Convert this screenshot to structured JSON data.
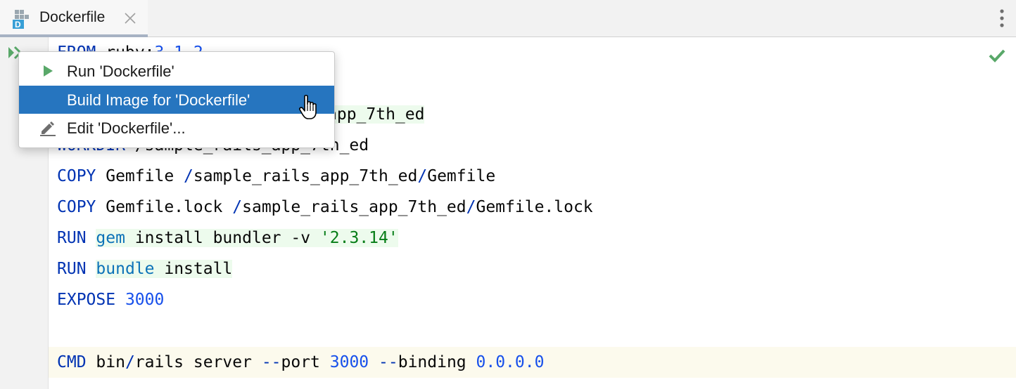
{
  "tab": {
    "title": "Dockerfile",
    "icon": "dockerfile-icon",
    "icon_letter": "D"
  },
  "menu": {
    "items": [
      {
        "label": "Run 'Dockerfile'",
        "icon": "run-icon"
      },
      {
        "label": "Build Image for 'Dockerfile'",
        "icon": "",
        "selected": true
      },
      {
        "label": "Edit 'Dockerfile'...",
        "icon": "edit-pencil-icon"
      }
    ]
  },
  "code": {
    "line1": {
      "kw": "FROM",
      "rest": " ruby:",
      "version": "3.1.2"
    },
    "line3": {
      "visible_tail": "app_7th_ed"
    },
    "line4": {
      "kw": "WORKDIR",
      "rest": " /sample_rails_app_7th_ed"
    },
    "line5": {
      "kw": "COPY",
      "a": " Gemfile ",
      "s1": "/",
      "b": "sample_rails_app_7th_ed",
      "s2": "/",
      "c": "Gemfile"
    },
    "line6": {
      "kw": "COPY",
      "a": " Gemfile.lock ",
      "s1": "/",
      "b": "sample_rails_app_7th_ed",
      "s2": "/",
      "c": "Gemfile.lock"
    },
    "line7": {
      "kw": "RUN",
      "cmd": "gem",
      "rest": " install bundler -v ",
      "str": "'2.3.14'"
    },
    "line8": {
      "kw": "RUN",
      "cmd": "bundle",
      "rest": " install"
    },
    "line9": {
      "kw": "EXPOSE",
      "num": "3000"
    },
    "line11": {
      "kw": "CMD",
      "a": " bin",
      "s1": "/",
      "b": "rails server ",
      "f1": "--",
      "c": "port ",
      "num1": "3000",
      "sp": " ",
      "f2": "--",
      "d": "binding ",
      "num2": "0.0.0.0"
    }
  },
  "colors": {
    "keyword": "#0033b3",
    "number": "#1750eb",
    "string": "#067d17",
    "selection": "#2675bf",
    "run_green": "#59a869"
  }
}
